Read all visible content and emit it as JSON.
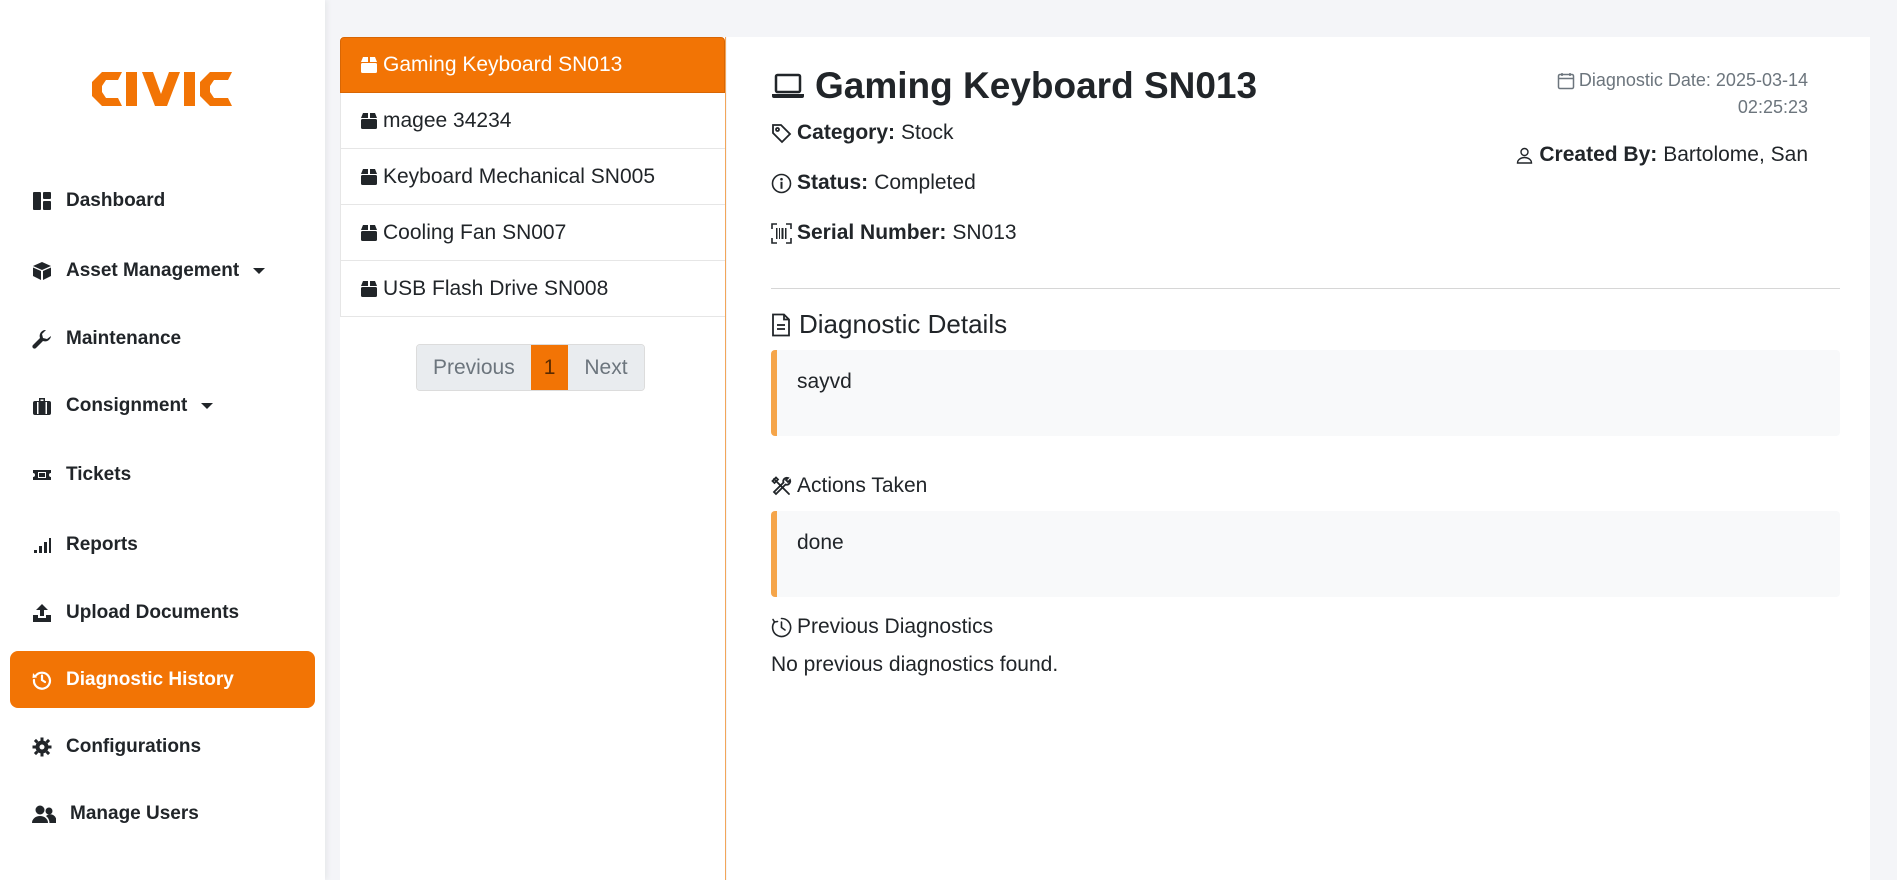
{
  "brand": {
    "name": "CIVIC",
    "color": "#f27405"
  },
  "sidebar": {
    "items": [
      {
        "label": "Dashboard",
        "icon": "dashboard-icon",
        "active": false,
        "has_caret": false
      },
      {
        "label": "Asset Management",
        "icon": "box-icon",
        "active": false,
        "has_caret": true
      },
      {
        "label": "Maintenance",
        "icon": "wrench-icon",
        "active": false,
        "has_caret": false
      },
      {
        "label": "Consignment",
        "icon": "briefcase-icon",
        "active": false,
        "has_caret": true
      },
      {
        "label": "Tickets",
        "icon": "ticket-icon",
        "active": false,
        "has_caret": false
      },
      {
        "label": "Reports",
        "icon": "signal-bars-icon",
        "active": false,
        "has_caret": false
      },
      {
        "label": "Upload Documents",
        "icon": "upload-icon",
        "active": false,
        "has_caret": false
      },
      {
        "label": "Diagnostic History",
        "icon": "history-icon",
        "active": true,
        "has_caret": false
      },
      {
        "label": "Configurations",
        "icon": "gear-icon",
        "active": false,
        "has_caret": false
      },
      {
        "label": "Manage Users",
        "icon": "users-icon",
        "active": false,
        "has_caret": false
      }
    ]
  },
  "asset_list": {
    "items": [
      {
        "label": "Gaming Keyboard SN013",
        "active": true
      },
      {
        "label": "magee 34234",
        "active": false
      },
      {
        "label": "Keyboard Mechanical SN005",
        "active": false
      },
      {
        "label": "Cooling Fan SN007",
        "active": false
      },
      {
        "label": "USB Flash Drive SN008",
        "active": false
      }
    ],
    "pagination": {
      "previous": "Previous",
      "current": "1",
      "next": "Next"
    }
  },
  "detail": {
    "title": "Gaming Keyboard SN013",
    "category_label": "Category:",
    "category_value": "Stock",
    "status_label": "Status:",
    "status_value": "Completed",
    "serial_label": "Serial Number:",
    "serial_value": "SN013",
    "date_line1": "Diagnostic Date: 2025-03-14",
    "date_line2": "02:25:23",
    "created_by_label": "Created By:",
    "created_by_value": "Bartolome, San",
    "diagnostic_details_heading": "Diagnostic Details",
    "diagnostic_details_text": "sayvd",
    "actions_heading": "Actions Taken",
    "actions_text": "done",
    "previous_heading": "Previous Diagnostics",
    "previous_text": "No previous diagnostics found."
  }
}
